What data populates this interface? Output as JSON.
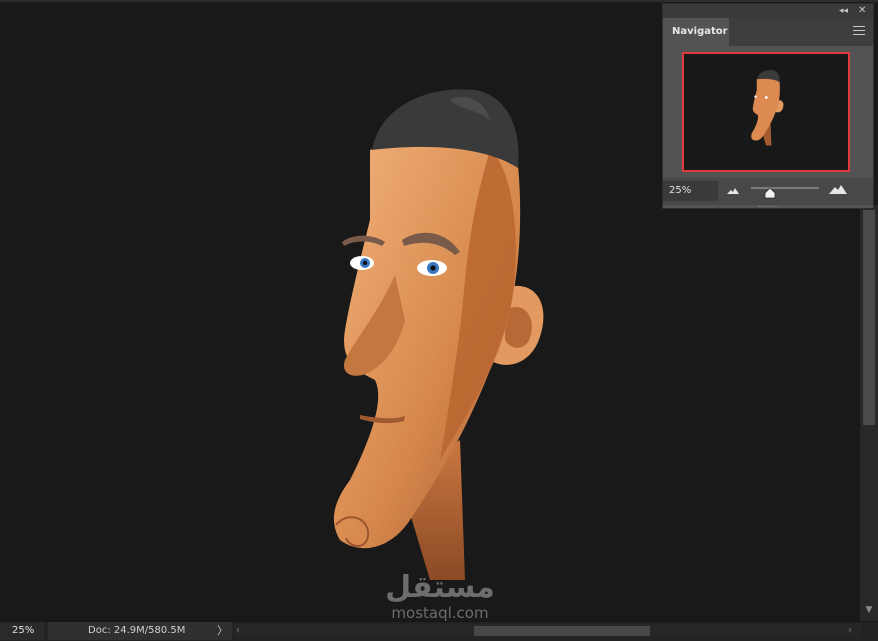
{
  "navigator": {
    "tab_label": "Navigator",
    "zoom_field": "25%",
    "collapse_glyph": "◂◂",
    "close_glyph": "✕",
    "menu_icon": "hamburger-icon",
    "view_box_color": "#e0393e",
    "zoom_slider_level": 0.28
  },
  "status": {
    "zoom": "25%",
    "doc_info": "Doc: 24.9M/580.5M",
    "arrow_glyph": "〉"
  },
  "scrollbars": {
    "left_glyph": "‹",
    "right_glyph": "›",
    "down_glyph": "▼"
  },
  "watermark": {
    "arabic": "مستقل",
    "latin": "mostaql.com"
  },
  "colors": {
    "canvas": "#191919",
    "panel": "#535353",
    "skin": "#e08a4f",
    "hair": "#3a3a3a"
  }
}
